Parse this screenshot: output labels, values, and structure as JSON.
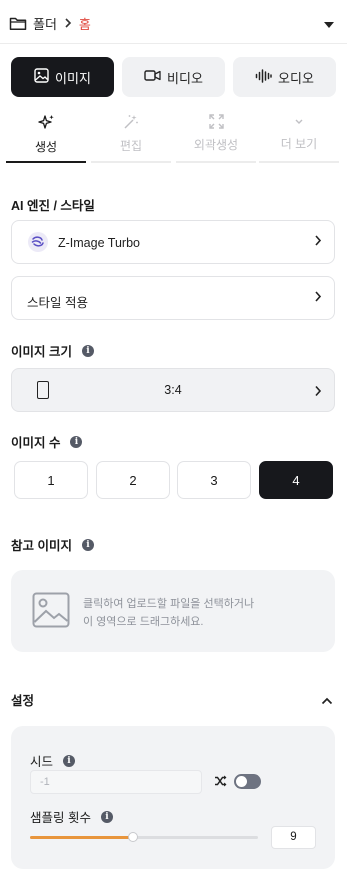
{
  "breadcrumb": {
    "folder_label": "폴더",
    "current": "홈"
  },
  "media_tabs": [
    {
      "label": "이미지",
      "icon": "image-icon",
      "active": true
    },
    {
      "label": "비디오",
      "icon": "video-icon",
      "active": false
    },
    {
      "label": "오디오",
      "icon": "audio-wave-icon",
      "active": false
    }
  ],
  "mode_tabs": [
    {
      "label": "생성",
      "icon": "sparkle-icon",
      "active": true
    },
    {
      "label": "편집",
      "icon": "magic-wand-icon",
      "active": false
    },
    {
      "label": "외곽생성",
      "icon": "expand-icon",
      "active": false
    },
    {
      "label": "더 보기",
      "icon": "chevron-down-icon",
      "active": false
    }
  ],
  "engine": {
    "title": "AI 엔진 / 스타일",
    "model": "Z-Image Turbo",
    "style_label": "스타일 적용"
  },
  "image_size": {
    "title": "이미지 크기",
    "ratio": "3:4"
  },
  "image_count": {
    "title": "이미지 수",
    "options": [
      "1",
      "2",
      "3",
      "4"
    ],
    "selected": "4"
  },
  "reference": {
    "title": "참고 이미지",
    "line1": "클릭하여 업로드할 파일을 선택하거나",
    "line2": "이 영역으로 드래그하세요."
  },
  "settings": {
    "title": "설정",
    "seed_label": "시드",
    "seed_placeholder": "-1",
    "random_seed_enabled": false,
    "steps_label": "샘플링 횟수",
    "steps_value": "9",
    "steps_fraction": 0.45
  },
  "colors": {
    "accent": "#e0483e",
    "dark": "#17181c",
    "slider": "#e8953c"
  }
}
